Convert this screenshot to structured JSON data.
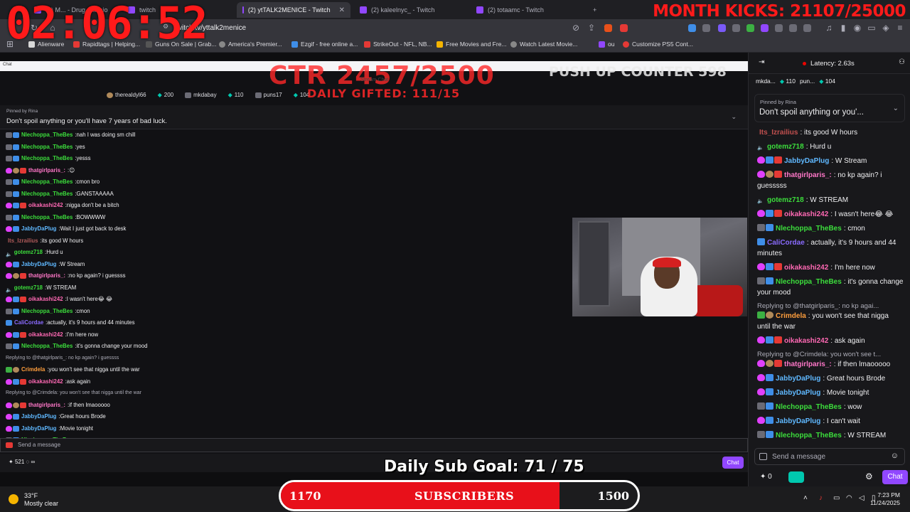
{
  "browser": {
    "tabs": [
      {
        "label": "(2) M... - Drug ...ansio",
        "active": false
      },
      {
        "label": "twitch",
        "active": false
      },
      {
        "label": "(2) ytTALK2MENICE - Twitch",
        "active": true
      },
      {
        "label": "(2) kaleelnyc_ - Twitch",
        "active": false
      },
      {
        "label": "(2) totaamc - Twitch",
        "active": false
      }
    ],
    "new_tab": "+",
    "url": "twitch.tv/yttalk2menice",
    "bookmarks": [
      "Alienware",
      "Rapidtags | Helping...",
      "Guns On Sale | Grab...",
      "America's Premier...",
      "Ezgif - free online a...",
      "StrikeOut - NFL, NB...",
      "Free Movies and Fre...",
      "Watch Latest Movie...",
      "ou",
      "Customize PS5 Cont..."
    ]
  },
  "overlays": {
    "timer": "02:06:52",
    "month_kicks": "MONTH KICKS: 21107/25000",
    "ctr": "CTR 2457/2500",
    "daily_gifted": "DAILY GIFTED: 111/15",
    "pushup": "PUSH UP COUNTER 598",
    "stream_chat": "Stream Chat",
    "daily_sub_goal": "Daily Sub Goal:  71 / 75",
    "sub_bar": {
      "left": "1170",
      "center": "SUBSCRIBERS",
      "right": "1500",
      "progress": 0.78
    }
  },
  "left_chat": {
    "header_label": "Chat",
    "top_chatters": [
      {
        "name": "therealdyl66",
        "count": ""
      },
      {
        "name": "",
        "count": "200"
      },
      {
        "name": "mkdabay",
        "count": ""
      },
      {
        "name": "",
        "count": "110"
      },
      {
        "name": "puns17",
        "count": ""
      },
      {
        "name": "",
        "count": "104"
      }
    ],
    "pinned_by": "Pinned by Rina",
    "pinned_msg": "Don't spoil anything or you'll have 7 years of bad luck.",
    "messages": [
      {
        "badges": [
          "grey",
          "blue"
        ],
        "user": "Nlechoppa_TheBes",
        "color": "#3cde3c",
        "text": "nah I was doing sm chill"
      },
      {
        "badges": [
          "grey",
          "blue"
        ],
        "user": "Nlechoppa_TheBes",
        "color": "#3cde3c",
        "text": "yes"
      },
      {
        "badges": [
          "grey",
          "blue"
        ],
        "user": "Nlechoppa_TheBes",
        "color": "#3cde3c",
        "text": "yesss"
      },
      {
        "badges": [
          "heart",
          "tan",
          "gift"
        ],
        "user": "thatgirlparis_:",
        "color": "#ff77c8",
        "text": "😊"
      },
      {
        "badges": [
          "grey",
          "blue"
        ],
        "user": "Nlechoppa_TheBes",
        "color": "#3cde3c",
        "text": "cmon bro"
      },
      {
        "badges": [
          "grey",
          "blue"
        ],
        "user": "Nlechoppa_TheBes",
        "color": "#3cde3c",
        "text": "GANSTAAAAA"
      },
      {
        "badges": [
          "heart",
          "blue",
          "gift"
        ],
        "user": "oikakashi242",
        "color": "#ff69b4",
        "text": "nigga don't be a bitch"
      },
      {
        "badges": [
          "grey",
          "blue"
        ],
        "user": "Nlechoppa_TheBes",
        "color": "#3cde3c",
        "text": "BOWWWW"
      },
      {
        "badges": [
          "heart",
          "blue"
        ],
        "user": "JabbyDaPlug",
        "color": "#5fb8ff",
        "text": "Wait I just got back to desk"
      },
      {
        "badges": [],
        "user": "Its_Izrailius",
        "color": "#b05a5a",
        "text": "its good W hours"
      },
      {
        "badges": [
          "speaker"
        ],
        "user": "gotemz718",
        "color": "#3cde3c",
        "text": "Hurd u"
      },
      {
        "badges": [
          "heart",
          "blue"
        ],
        "user": "JabbyDaPlug",
        "color": "#5fb8ff",
        "text": "W Stream"
      },
      {
        "badges": [
          "heart",
          "tan",
          "gift"
        ],
        "user": "thatgirlparis_:",
        "color": "#ff77c8",
        "text": "no kp again? i guessss"
      },
      {
        "badges": [
          "speaker"
        ],
        "user": "gotemz718",
        "color": "#3cde3c",
        "text": "W STREAM"
      },
      {
        "badges": [
          "heart",
          "blue",
          "gift"
        ],
        "user": "oikakashi242",
        "color": "#ff69b4",
        "text": "I wasn't here😂 😂"
      },
      {
        "badges": [
          "grey",
          "blue"
        ],
        "user": "Nlechoppa_TheBes",
        "color": "#3cde3c",
        "text": "cmon"
      },
      {
        "badges": [
          "blue"
        ],
        "user": "CaliCordae",
        "color": "#8a6bff",
        "text": "actually, it's 9 hours and 44 minutes"
      },
      {
        "badges": [
          "heart",
          "blue",
          "gift"
        ],
        "user": "oikakashi242",
        "color": "#ff69b4",
        "text": "I'm here now"
      },
      {
        "badges": [
          "grey",
          "blue"
        ],
        "user": "Nlechoppa_TheBes",
        "color": "#3cde3c",
        "text": "it's gonna change your mood"
      },
      {
        "reply": "Replying to @thatgirlparis_: no kp again? i guessss"
      },
      {
        "badges": [
          "green",
          "tan"
        ],
        "user": "Crimdela",
        "color": "#ff9e3d",
        "text": "you won't see that nigga until the war"
      },
      {
        "badges": [
          "heart",
          "blue",
          "gift"
        ],
        "user": "oikakashi242",
        "color": "#ff69b4",
        "text": "ask again"
      },
      {
        "reply": "Replying to @Crimdela: you won't see that nigga until the war"
      },
      {
        "badges": [
          "heart",
          "tan",
          "gift"
        ],
        "user": "thatgirlparis_:",
        "color": "#ff77c8",
        "text": "if then lmaooooo"
      },
      {
        "badges": [
          "heart",
          "blue"
        ],
        "user": "JabbyDaPlug",
        "color": "#5fb8ff",
        "text": "Great hours Brode"
      },
      {
        "badges": [
          "heart",
          "blue"
        ],
        "user": "JabbyDaPlug",
        "color": "#5fb8ff",
        "text": "Movie tonight"
      },
      {
        "badges": [
          "grey",
          "blue"
        ],
        "user": "Nlechoppa_TheBes",
        "color": "#3cde3c",
        "text": "wow"
      }
    ],
    "composer_placeholder": "Send a message",
    "points": "521",
    "chat_button": "Chat"
  },
  "right_chat": {
    "latency": "Latency: 2.63s",
    "top_chatters": [
      "mkda...",
      "110",
      "pun...",
      "104"
    ],
    "pinned_by": "Pinned by Rina",
    "pinned_msg": "Don't spoil anything or you'...",
    "messages": [
      {
        "badges": [],
        "user": "Its_Izrailius",
        "color": "#c2504f",
        "text": "its good W hours"
      },
      {
        "badges": [
          "speaker"
        ],
        "user": "gotemz718",
        "color": "#3cde3c",
        "text": "Hurd u"
      },
      {
        "badges": [
          "heart",
          "blue",
          "gift"
        ],
        "user": "JabbyDaPlug",
        "color": "#5fb8ff",
        "text": "W Stream"
      },
      {
        "badges": [
          "heart",
          "tan",
          "gift"
        ],
        "user": "thatgirlparis_:",
        "color": "#ff77c8",
        "text": "no kp again? i guesssss"
      },
      {
        "badges": [
          "speaker"
        ],
        "user": "gotemz718",
        "color": "#3cde3c",
        "text": "W STREAM"
      },
      {
        "badges": [
          "heart",
          "blue",
          "gift"
        ],
        "user": "oikakashi242",
        "color": "#ff69b4",
        "text": "I wasn't here😂 😂"
      },
      {
        "badges": [
          "grey",
          "blue"
        ],
        "user": "Nlechoppa_TheBes",
        "color": "#3cde3c",
        "text": "cmon"
      },
      {
        "badges": [
          "blue"
        ],
        "user": "CaliCordae",
        "color": "#8a6bff",
        "text": "actually, it's 9 hours and 44 minutes"
      },
      {
        "badges": [
          "heart",
          "blue",
          "gift"
        ],
        "user": "oikakashi242",
        "color": "#ff69b4",
        "text": "I'm here now"
      },
      {
        "badges": [
          "grey",
          "blue"
        ],
        "user": "Nlechoppa_TheBes",
        "color": "#3cde3c",
        "text": "it's gonna change your mood"
      },
      {
        "reply": "Replying to @thatgirlparis_: no kp agai..."
      },
      {
        "badges": [
          "green",
          "tan"
        ],
        "user": "Crimdela",
        "color": "#ff9e3d",
        "text": "you won't see that nigga until the war"
      },
      {
        "badges": [
          "heart",
          "blue",
          "gift"
        ],
        "user": "oikakashi242",
        "color": "#ff69b4",
        "text": "ask again"
      },
      {
        "reply": "Replying to @Crimdela: you won't see t..."
      },
      {
        "badges": [
          "heart",
          "tan",
          "gift"
        ],
        "user": "thatgirlparis_:",
        "color": "#ff77c8",
        "text": "if then lmaooooo"
      },
      {
        "badges": [
          "heart",
          "blue"
        ],
        "user": "JabbyDaPlug",
        "color": "#5fb8ff",
        "text": "Great hours Brode"
      },
      {
        "badges": [
          "heart",
          "blue"
        ],
        "user": "JabbyDaPlug",
        "color": "#5fb8ff",
        "text": "Movie tonight"
      },
      {
        "badges": [
          "grey",
          "blue"
        ],
        "user": "Nlechoppa_TheBes",
        "color": "#3cde3c",
        "text": "wow"
      },
      {
        "badges": [
          "heart",
          "blue"
        ],
        "user": "JabbyDaPlug",
        "color": "#5fb8ff",
        "text": "I can't wait"
      },
      {
        "badges": [
          "grey",
          "blue"
        ],
        "user": "Nlechoppa_TheBes",
        "color": "#3cde3c",
        "text": "W STREAM"
      }
    ],
    "composer_placeholder": "Send a message",
    "points": "0",
    "chat_button": "Chat"
  },
  "taskbar": {
    "temp": "33°F",
    "condition": "Mostly clear",
    "time": "7:23 PM",
    "date": "11/24/2025"
  }
}
